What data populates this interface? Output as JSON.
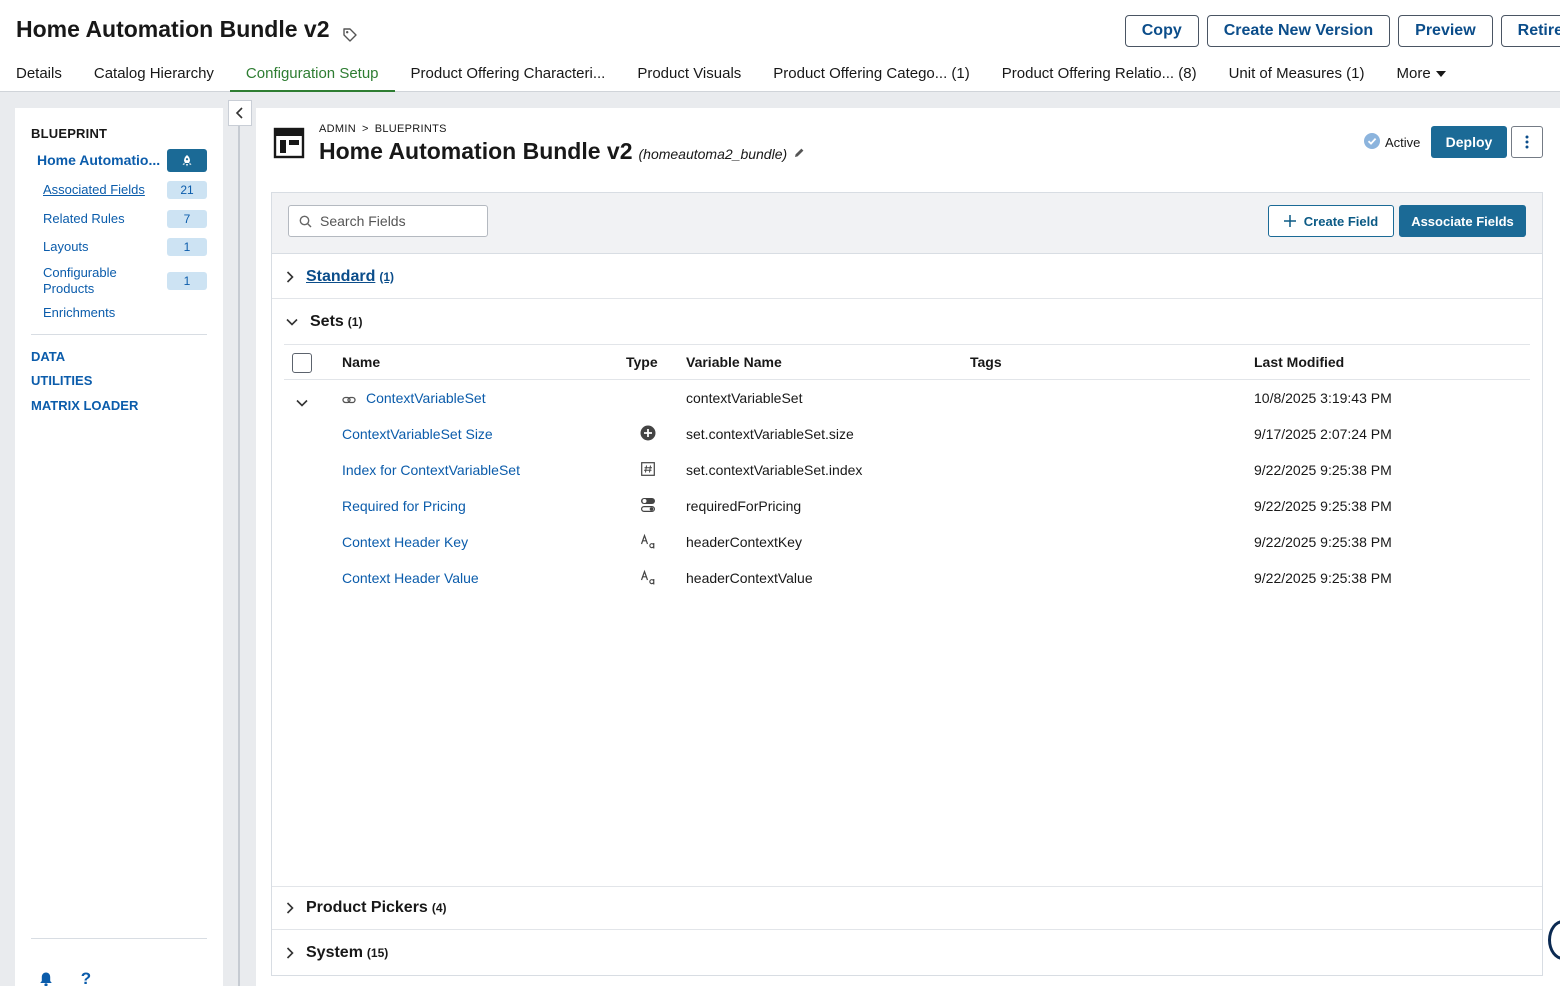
{
  "header": {
    "title": "Home Automation Bundle v2",
    "actions": {
      "copy": "Copy",
      "create_new_version": "Create New Version",
      "preview": "Preview",
      "retire": "Retire"
    }
  },
  "tabs": [
    {
      "label": "Details"
    },
    {
      "label": "Catalog Hierarchy"
    },
    {
      "label": "Configuration Setup"
    },
    {
      "label": "Product Offering Characteri..."
    },
    {
      "label": "Product Visuals"
    },
    {
      "label": "Product Offering Catego...  (1)"
    },
    {
      "label": "Product Offering Relatio...  (8)"
    },
    {
      "label": "Unit of Measures (1)"
    },
    {
      "label": "More"
    }
  ],
  "sidebar": {
    "heading": "BLUEPRINT",
    "current": "Home Automatio...",
    "items": [
      {
        "label": "Associated Fields",
        "count": "21"
      },
      {
        "label": "Related Rules",
        "count": "7"
      },
      {
        "label": "Layouts",
        "count": "1"
      },
      {
        "label": "Configurable Products",
        "count": "1"
      },
      {
        "label": "Enrichments"
      }
    ],
    "links": [
      "DATA",
      "UTILITIES",
      "MATRIX LOADER"
    ]
  },
  "main": {
    "breadcrumb": [
      "ADMIN",
      "BLUEPRINTS"
    ],
    "breadcrumb_sep": ">",
    "title": "Home Automation Bundle v2",
    "api_name": "(homeautoma2_bundle)",
    "status": "Active",
    "deploy": "Deploy"
  },
  "panel": {
    "search_placeholder": "Search Fields",
    "create_field": "Create Field",
    "associate_fields": "Associate Fields",
    "groups": {
      "standard": {
        "label": "Standard",
        "count": "(1)"
      },
      "sets": {
        "label": "Sets",
        "count": "(1)"
      },
      "product_pickers": {
        "label": "Product Pickers",
        "count": "(4)"
      },
      "system": {
        "label": "System",
        "count": "(15)"
      }
    },
    "columns": {
      "name": "Name",
      "type": "Type",
      "variable": "Variable Name",
      "tags": "Tags",
      "modified": "Last Modified"
    },
    "rows": [
      {
        "name": "ContextVariableSet",
        "type_icon": "link-icon",
        "variable": "contextVariableSet",
        "modified": "10/8/2025 3:19:43 PM"
      },
      {
        "name": "ContextVariableSet Size",
        "type_icon": "plus-circle-icon",
        "variable": "set.contextVariableSet.size",
        "modified": "9/17/2025 2:07:24 PM"
      },
      {
        "name": "Index for ContextVariableSet",
        "type_icon": "hash-icon",
        "variable": "set.contextVariableSet.index",
        "modified": "9/22/2025 9:25:38 PM"
      },
      {
        "name": "Required for Pricing",
        "type_icon": "toggle-icon",
        "variable": "requiredForPricing",
        "modified": "9/22/2025 9:25:38 PM"
      },
      {
        "name": "Context Header Key",
        "type_icon": "text-type-icon",
        "variable": "headerContextKey",
        "modified": "9/22/2025 9:25:38 PM"
      },
      {
        "name": "Context Header Value",
        "type_icon": "text-type-icon",
        "variable": "headerContextValue",
        "modified": "9/22/2025 9:25:38 PM"
      }
    ]
  },
  "colors": {
    "accent": "#1b6a96",
    "link": "#0b5cab",
    "active_tab": "#2e7d32"
  }
}
